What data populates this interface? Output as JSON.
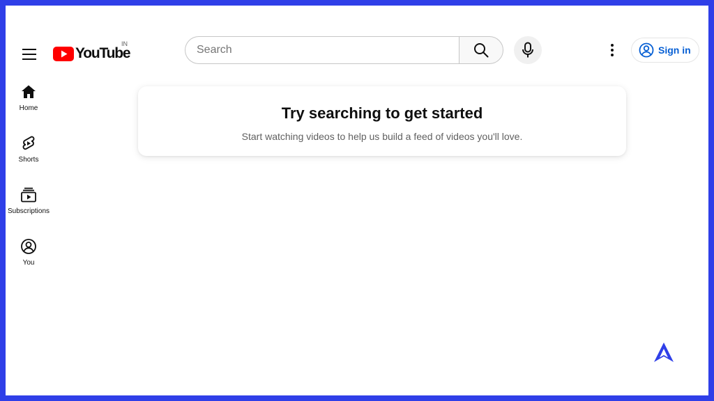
{
  "header": {
    "logo_text": "YouTube",
    "region": "IN",
    "search": {
      "placeholder": "Search",
      "value": ""
    },
    "signin_label": "Sign in"
  },
  "sidebar": {
    "items": [
      {
        "label": "Home",
        "icon": "home-icon"
      },
      {
        "label": "Shorts",
        "icon": "shorts-icon"
      },
      {
        "label": "Subscriptions",
        "icon": "subscriptions-icon"
      },
      {
        "label": "You",
        "icon": "you-icon"
      }
    ]
  },
  "main": {
    "title": "Try searching to get started",
    "subtitle": "Start watching videos to help us build a feed of videos you'll love."
  },
  "colors": {
    "frame_border": "#2f3fe8",
    "youtube_red": "#ff0000",
    "signin_blue": "#065fd4"
  }
}
